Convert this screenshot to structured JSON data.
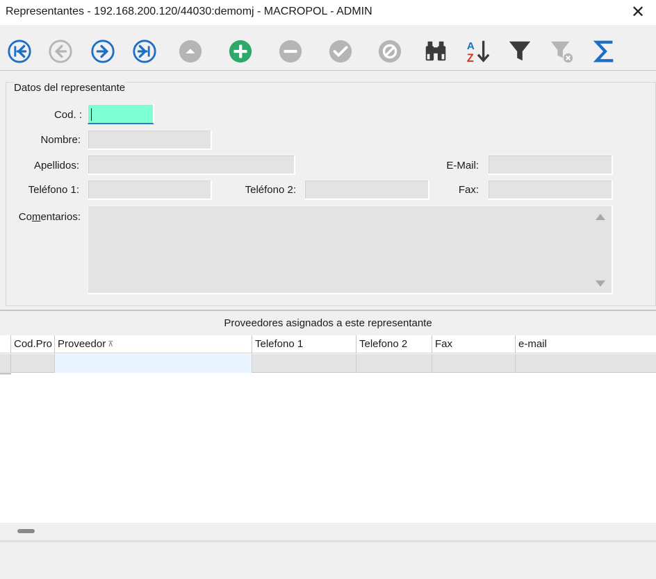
{
  "window": {
    "title": "Representantes - 192.168.200.120/44030:demomj - MACROPOL - ADMIN",
    "close_glyph": "✕"
  },
  "toolbar": {
    "buttons": [
      {
        "name": "first-record-button",
        "icon": "first-icon",
        "enabled": true
      },
      {
        "name": "previous-record-button",
        "icon": "previous-icon",
        "enabled": false
      },
      {
        "name": "next-record-button",
        "icon": "next-icon",
        "enabled": true
      },
      {
        "name": "last-record-button",
        "icon": "last-icon",
        "enabled": true
      },
      {
        "name": "up-button",
        "icon": "up-icon",
        "enabled": false
      },
      {
        "name": "add-record-button",
        "icon": "plus-icon",
        "enabled": true
      },
      {
        "name": "delete-record-button",
        "icon": "minus-icon",
        "enabled": false
      },
      {
        "name": "confirm-button",
        "icon": "checkmark-icon",
        "enabled": false
      },
      {
        "name": "cancel-button",
        "icon": "cancel-icon",
        "enabled": false
      },
      {
        "name": "search-button",
        "icon": "binoculars-icon",
        "enabled": true
      },
      {
        "name": "sort-button",
        "icon": "sort-az-icon",
        "enabled": true
      },
      {
        "name": "filter-button",
        "icon": "filter-icon",
        "enabled": true
      },
      {
        "name": "clear-filter-button",
        "icon": "filter-clear-icon",
        "enabled": false
      },
      {
        "name": "sum-button",
        "icon": "sigma-icon",
        "enabled": true
      }
    ],
    "colors": {
      "blue": "#1e6fc4",
      "green": "#2fa86a",
      "disabled": "#b5b5b5",
      "dark": "#3a3a3a"
    }
  },
  "form": {
    "group_title": "Datos del representante",
    "labels": {
      "cod": "Cod. :",
      "nombre": "Nombre:",
      "apellidos": "Apellidos:",
      "email": "E-Mail:",
      "telefono1": "Teléfono 1:",
      "telefono2": "Teléfono 2:",
      "fax": "Fax:",
      "comentarios_pre": "Co",
      "comentarios_u": "m",
      "comentarios_post": "entarios:"
    },
    "values": {
      "cod": "",
      "nombre": "",
      "apellidos": "",
      "email": "",
      "telefono1": "",
      "telefono2": "",
      "fax": "",
      "comentarios": ""
    },
    "active_field_color": "#7fffd4"
  },
  "grid": {
    "caption": "Proveedores asignados a este representante",
    "columns": [
      "Cod.Pro",
      "Proveedor",
      "Telefono 1",
      "Telefono 2",
      "Fax",
      "e-mail"
    ],
    "rows": [
      [
        "",
        "",
        "",
        "",
        "",
        ""
      ]
    ]
  }
}
